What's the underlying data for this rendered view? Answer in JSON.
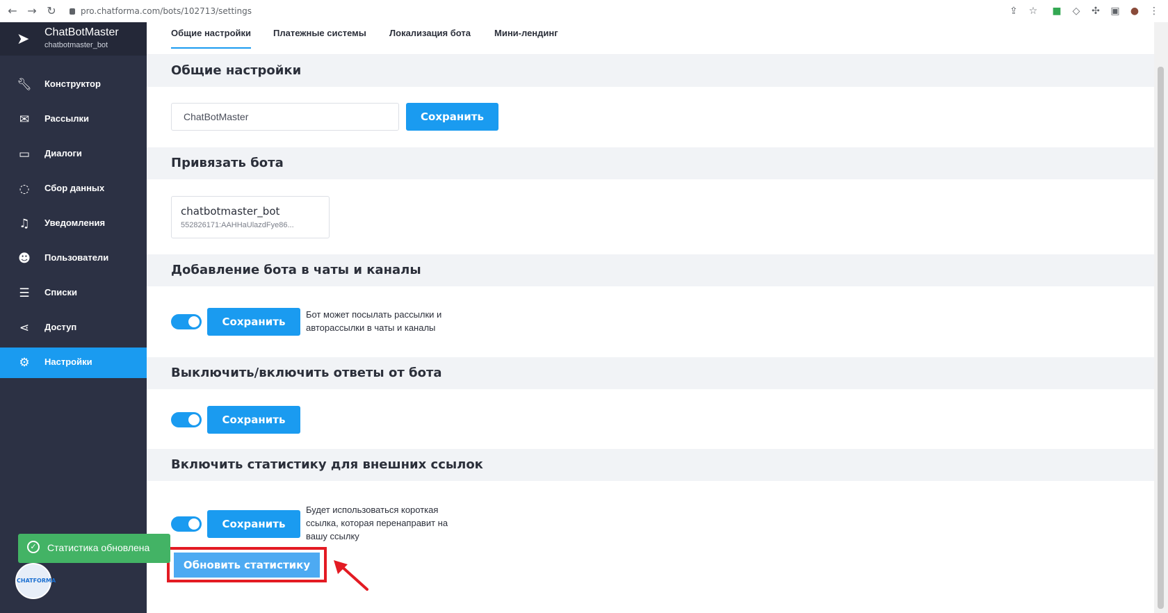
{
  "browser": {
    "url": "pro.chatforma.com/bots/102713/settings"
  },
  "brand": {
    "title": "ChatBotMaster",
    "subtitle": "chatbotmaster_bot"
  },
  "sidebar": {
    "items": [
      {
        "label": "Конструктор",
        "icon": "wrench-icon"
      },
      {
        "label": "Рассылки",
        "icon": "envelope-icon"
      },
      {
        "label": "Диалоги",
        "icon": "chat-icon"
      },
      {
        "label": "Сбор данных",
        "icon": "refresh-icon"
      },
      {
        "label": "Уведомления",
        "icon": "bell-icon"
      },
      {
        "label": "Пользователи",
        "icon": "users-icon"
      },
      {
        "label": "Списки",
        "icon": "list-icon"
      },
      {
        "label": "Доступ",
        "icon": "share-icon"
      },
      {
        "label": "Настройки",
        "icon": "gear-icon",
        "active": true
      }
    ]
  },
  "tabs": [
    {
      "label": "Общие настройки",
      "active": true
    },
    {
      "label": "Платежные системы"
    },
    {
      "label": "Локализация бота"
    },
    {
      "label": "Мини-лендинг"
    }
  ],
  "sections": {
    "general": {
      "title": "Общие настройки",
      "bot_name_value": "ChatBotMaster",
      "save_label": "Сохранить"
    },
    "bind": {
      "title": "Привязать бота",
      "bot_username": "chatbotmaster_bot",
      "bot_token": "552826171:AAHHaUlazdFye86..."
    },
    "chats": {
      "title": "Добавление бота в чаты и каналы",
      "save_label": "Сохранить",
      "description_line1": "Бот может посылать рассылки и",
      "description_line2": "авторассылки в чаты и каналы",
      "enabled": true
    },
    "replies": {
      "title": "Выключить/включить ответы от бота",
      "save_label": "Сохранить",
      "enabled": true
    },
    "stats": {
      "title": "Включить статистику для внешних ссылок",
      "save_label": "Сохранить",
      "description_line1": "Будет использоваться короткая",
      "description_line2": "ссылка, которая перенаправит на",
      "description_line3": "вашу ссылку",
      "enabled": true,
      "refresh_label": "Обновить статистику"
    }
  },
  "toast": {
    "message": "Статистика обновлена"
  },
  "colors": {
    "accent": "#1a9bf0",
    "sidebar": "#2c3144",
    "success": "#43b365",
    "highlight": "#e31b23"
  }
}
